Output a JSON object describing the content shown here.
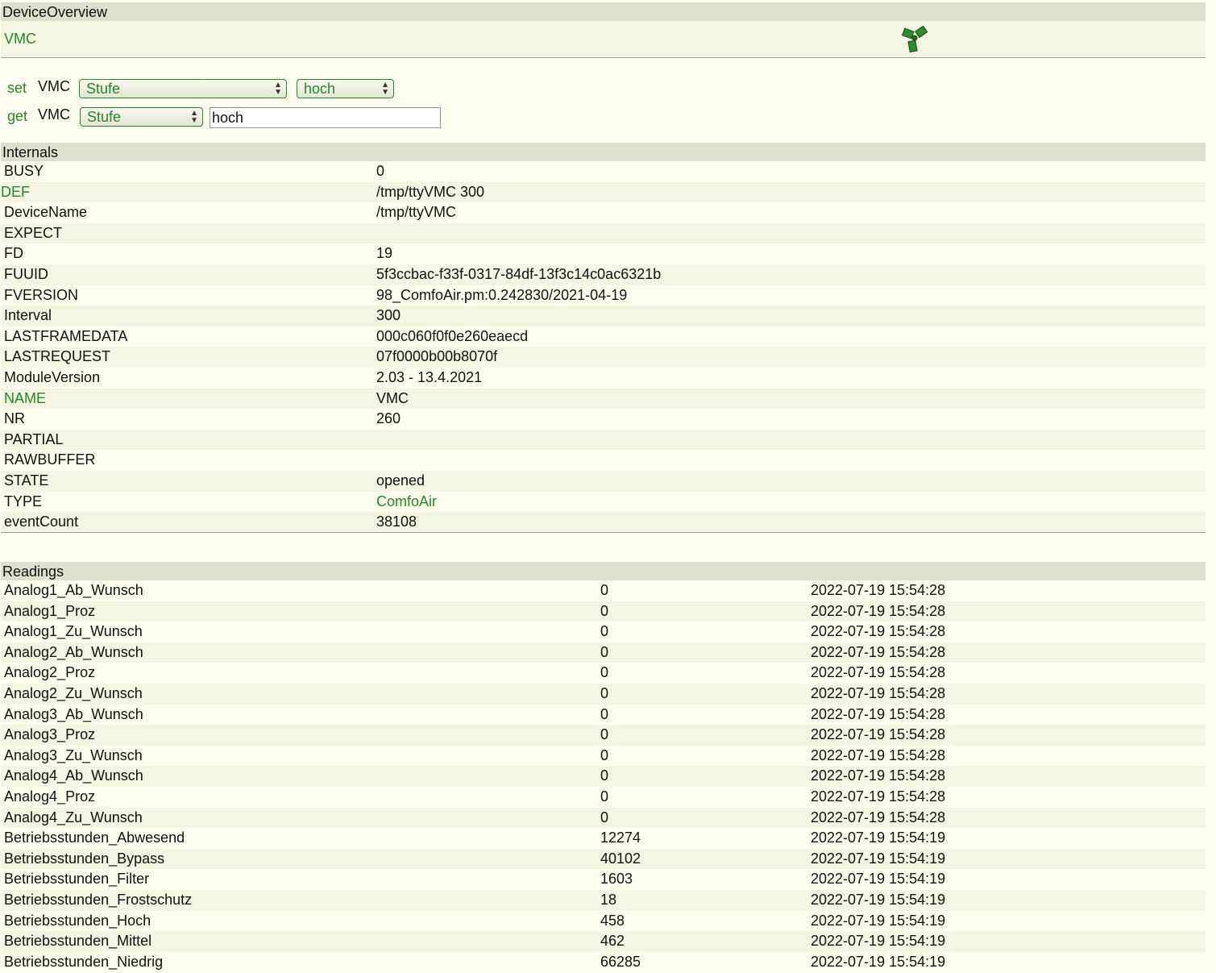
{
  "header": {
    "title": "DeviceOverview"
  },
  "device": {
    "name": "VMC",
    "icon": "fan-icon"
  },
  "set_row": {
    "label": "set",
    "device": "VMC",
    "command": "Stufe",
    "value": "hoch"
  },
  "get_row": {
    "label": "get",
    "device": "VMC",
    "command": "Stufe",
    "value": "hoch"
  },
  "internals": {
    "title": "Internals",
    "rows": [
      {
        "name": "BUSY",
        "value": "0"
      },
      {
        "name": "DEF",
        "value": "/tmp/ttyVMC 300"
      },
      {
        "name": "DeviceName",
        "value": "/tmp/ttyVMC"
      },
      {
        "name": "EXPECT",
        "value": ""
      },
      {
        "name": "FD",
        "value": "19"
      },
      {
        "name": "FUUID",
        "value": "5f3ccbac-f33f-0317-84df-13f3c14c0ac6321b"
      },
      {
        "name": "FVERSION",
        "value": "98_ComfoAir.pm:0.242830/2021-04-19"
      },
      {
        "name": "Interval",
        "value": "300"
      },
      {
        "name": "LASTFRAMEDATA",
        "value": "000c060f0f0e260eaecd"
      },
      {
        "name": "LASTREQUEST",
        "value": "07f0000b00b8070f"
      },
      {
        "name": "ModuleVersion",
        "value": "2.03 - 13.4.2021"
      },
      {
        "name": "NAME",
        "value": "VMC"
      },
      {
        "name": "NR",
        "value": "260"
      },
      {
        "name": "PARTIAL",
        "value": ""
      },
      {
        "name": "RAWBUFFER",
        "value": ""
      },
      {
        "name": "STATE",
        "value": "opened"
      },
      {
        "name": "TYPE",
        "value": "ComfoAir"
      },
      {
        "name": "eventCount",
        "value": "38108"
      }
    ]
  },
  "readings": {
    "title": "Readings",
    "rows": [
      {
        "name": "Analog1_Ab_Wunsch",
        "value": "0",
        "time": "2022-07-19 15:54:28"
      },
      {
        "name": "Analog1_Proz",
        "value": "0",
        "time": "2022-07-19 15:54:28"
      },
      {
        "name": "Analog1_Zu_Wunsch",
        "value": "0",
        "time": "2022-07-19 15:54:28"
      },
      {
        "name": "Analog2_Ab_Wunsch",
        "value": "0",
        "time": "2022-07-19 15:54:28"
      },
      {
        "name": "Analog2_Proz",
        "value": "0",
        "time": "2022-07-19 15:54:28"
      },
      {
        "name": "Analog2_Zu_Wunsch",
        "value": "0",
        "time": "2022-07-19 15:54:28"
      },
      {
        "name": "Analog3_Ab_Wunsch",
        "value": "0",
        "time": "2022-07-19 15:54:28"
      },
      {
        "name": "Analog3_Proz",
        "value": "0",
        "time": "2022-07-19 15:54:28"
      },
      {
        "name": "Analog3_Zu_Wunsch",
        "value": "0",
        "time": "2022-07-19 15:54:28"
      },
      {
        "name": "Analog4_Ab_Wunsch",
        "value": "0",
        "time": "2022-07-19 15:54:28"
      },
      {
        "name": "Analog4_Proz",
        "value": "0",
        "time": "2022-07-19 15:54:28"
      },
      {
        "name": "Analog4_Zu_Wunsch",
        "value": "0",
        "time": "2022-07-19 15:54:28"
      },
      {
        "name": "Betriebsstunden_Abwesend",
        "value": "12274",
        "time": "2022-07-19 15:54:19"
      },
      {
        "name": "Betriebsstunden_Bypass",
        "value": "40102",
        "time": "2022-07-19 15:54:19"
      },
      {
        "name": "Betriebsstunden_Filter",
        "value": "1603",
        "time": "2022-07-19 15:54:19"
      },
      {
        "name": "Betriebsstunden_Frostschutz",
        "value": "18",
        "time": "2022-07-19 15:54:19"
      },
      {
        "name": "Betriebsstunden_Hoch",
        "value": "458",
        "time": "2022-07-19 15:54:19"
      },
      {
        "name": "Betriebsstunden_Mittel",
        "value": "462",
        "time": "2022-07-19 15:54:19"
      },
      {
        "name": "Betriebsstunden_Niedrig",
        "value": "66285",
        "time": "2022-07-19 15:54:19"
      }
    ]
  },
  "colors": {
    "link": "#278727",
    "header_bg": "#dfdfcf",
    "row_alt": "#f5f5e3",
    "page_bg": "#fffff0"
  }
}
